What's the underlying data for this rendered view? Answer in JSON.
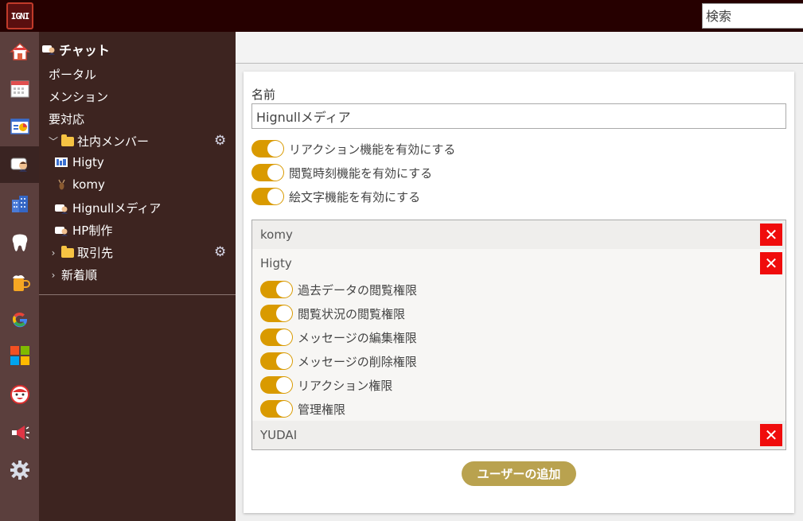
{
  "topbar": {
    "logo_text": "IGNI",
    "search_placeholder": "検索"
  },
  "rail": {
    "items": [
      {
        "icon": "home-icon"
      },
      {
        "icon": "calendar-icon"
      },
      {
        "icon": "dashboard-icon"
      },
      {
        "icon": "chat-icon",
        "active": true
      },
      {
        "icon": "building-icon"
      },
      {
        "icon": "tooth-icon"
      },
      {
        "icon": "beer-icon"
      },
      {
        "icon": "google-icon"
      },
      {
        "icon": "microsoft-icon"
      },
      {
        "icon": "face-icon"
      },
      {
        "icon": "megaphone-icon"
      },
      {
        "icon": "gear-icon"
      }
    ]
  },
  "sidebar": {
    "title": "チャット",
    "portal": "ポータル",
    "mention": "メンション",
    "todo": "要対応",
    "group1": "社内メンバー",
    "channels": [
      "Higty",
      "komy",
      "Hignullメディア",
      "HP制作"
    ],
    "group2": "取引先",
    "newest": "新着順"
  },
  "form": {
    "name_label": "名前",
    "name_value": "Hignullメディア",
    "toggles": [
      "リアクション機能を有効にする",
      "閲覧時刻機能を有効にする",
      "絵文字機能を有効にする"
    ]
  },
  "users": {
    "komy": "komy",
    "higty": "Higty",
    "yudai": "YUDAI",
    "remove_symbol": "✕",
    "permissions": [
      "過去データの閲覧権限",
      "閲覧状況の閲覧権限",
      "メッセージの編集権限",
      "メッセージの削除権限",
      "リアクション権限",
      "管理権限"
    ]
  },
  "add_user_button": "ユーザーの追加",
  "colors": {
    "topbar": "#260000",
    "rail": "#5b3f3d",
    "sidebar": "#3d2420",
    "toggle_on": "#d99a00",
    "remove": "#f00c0c",
    "add_button": "#b9a24f"
  }
}
